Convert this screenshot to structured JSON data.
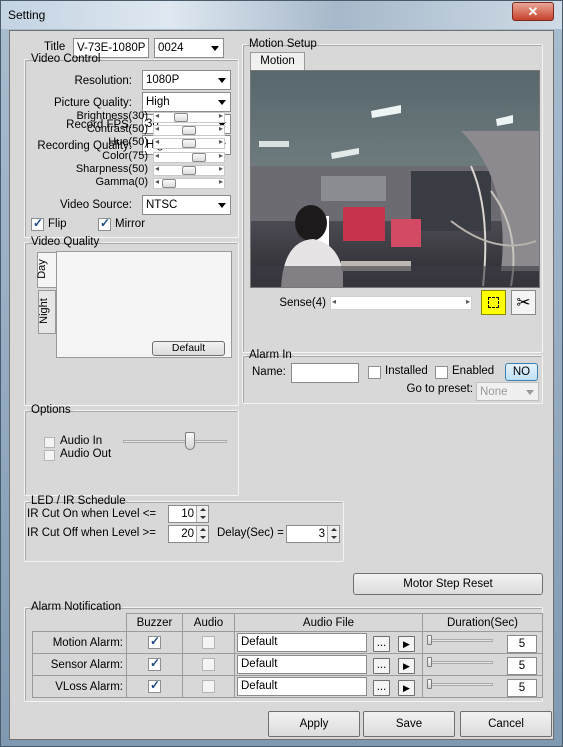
{
  "window": {
    "title": "Setting",
    "close_glyph": "✕"
  },
  "title_row": {
    "label": "Title",
    "name_value": "V-73E-1080P",
    "id_value": "0024"
  },
  "video_control": {
    "legend": "Video Control",
    "resolution_label": "Resolution:",
    "resolution_value": "1080P",
    "picture_quality_label": "Picture Quality:",
    "picture_quality_value": "High",
    "record_fps_label": "Record FPS:",
    "record_fps_value": "30",
    "recording_quality_label": "Recording Quality:",
    "recording_quality_value": "High",
    "video_source_label": "Video Source:",
    "video_source_value": "NTSC",
    "flip_label": "Flip",
    "flip_checked": true,
    "mirror_label": "Mirror",
    "mirror_checked": true
  },
  "video_quality": {
    "legend": "Video Quality",
    "tabs": [
      "Day",
      "Night"
    ],
    "params": [
      {
        "label": "Brightness(30)",
        "level": 30
      },
      {
        "label": "Contrast(50)",
        "level": 50
      },
      {
        "label": "Hue(50)",
        "level": 50
      },
      {
        "label": "Color(75)",
        "level": 75
      },
      {
        "label": "Sharpness(50)",
        "level": 50
      },
      {
        "label": "Gamma(0)",
        "level": 0
      }
    ],
    "default_label": "Default"
  },
  "motion_setup": {
    "legend": "Motion Setup",
    "tab_label": "Motion",
    "sense_label": "Sense(4)",
    "sense_level": 4
  },
  "alarm_in": {
    "legend": "Alarm In",
    "name_label": "Name:",
    "name_value": "",
    "installed_label": "Installed",
    "installed_checked": false,
    "enabled_label": "Enabled",
    "enabled_checked": false,
    "no_label": "NO",
    "goto_label": "Go to preset:",
    "goto_value": "None"
  },
  "options": {
    "legend": "Options",
    "audio_in_label": "Audio In",
    "audio_out_label": "Audio Out"
  },
  "led_ir": {
    "legend": "LED / IR Schedule",
    "ir_on_label": "IR Cut On when Level <=",
    "ir_on_value": "10",
    "ir_off_label": "IR Cut Off when Level >=",
    "ir_off_value": "20",
    "delay_label": "Delay(Sec) =",
    "delay_value": "3"
  },
  "motor_step_reset_label": "Motor Step Reset",
  "alarm_notification": {
    "legend": "Alarm Notification",
    "headers": [
      "Buzzer",
      "Audio",
      "Audio File",
      "Duration(Sec)"
    ],
    "rows": [
      {
        "label": "Motion Alarm:",
        "buzzer": true,
        "audio": false,
        "file": "Default",
        "duration": "5"
      },
      {
        "label": "Sensor Alarm:",
        "buzzer": true,
        "audio": false,
        "file": "Default",
        "duration": "5"
      },
      {
        "label": "VLoss Alarm:",
        "buzzer": true,
        "audio": false,
        "file": "Default",
        "duration": "5"
      }
    ],
    "browse_label": "...",
    "play_glyph": "▶"
  },
  "footer": {
    "apply_label": "Apply",
    "save_label": "Save",
    "cancel_label": "Cancel"
  },
  "icons": {
    "select_region": "dashed-square-icon",
    "clear": "scissors-icon"
  },
  "colors": {
    "select_region_bg": "#ffff00",
    "no_button_bg": "#cde6f7"
  }
}
